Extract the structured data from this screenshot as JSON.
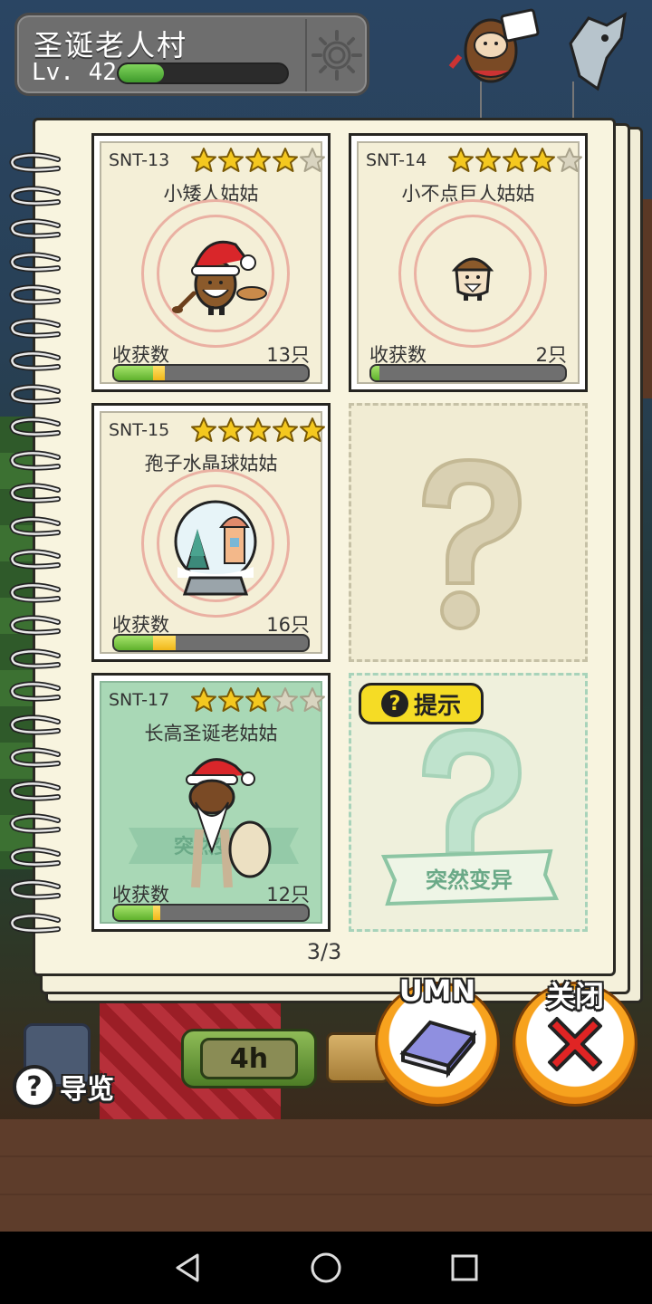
{
  "hud": {
    "village_name": "圣诞老人村",
    "level_text": "Lv. 42",
    "xp_progress": 0.27
  },
  "cards": [
    {
      "id": "SNT-13",
      "stars": 4,
      "name": "小矮人姑姑",
      "harvest_label": "收获数",
      "count": "13只",
      "progress_green": 0.2,
      "progress_yellow": 0.06,
      "style": "normal"
    },
    {
      "id": "SNT-14",
      "stars": 4,
      "name": "小不点巨人姑姑",
      "harvest_label": "收获数",
      "count": "2只",
      "progress_green": 0.04,
      "progress_yellow": 0.0,
      "style": "normal"
    },
    {
      "id": "SNT-15",
      "stars": 5,
      "name": "孢子水晶球姑姑",
      "harvest_label": "收获数",
      "count": "16只",
      "progress_green": 0.2,
      "progress_yellow": 0.12,
      "style": "normal"
    },
    {
      "id": "SNT-17",
      "stars": 3,
      "name": "长高圣诞老姑姑",
      "harvest_label": "收获数",
      "count": "12只",
      "progress_green": 0.2,
      "progress_yellow": 0.04,
      "style": "mutation",
      "ribbon": "突然变异"
    }
  ],
  "mystery_slots": [
    {
      "type": "unknown"
    },
    {
      "type": "hint",
      "hint_label": "提示",
      "ribbon": "突然变异"
    }
  ],
  "page_indicator": "3/3",
  "bottom": {
    "guide_label": "导览",
    "timer_text": "4h",
    "umn_label": "UMN",
    "close_label": "关闭"
  },
  "icons": [
    "settings-gear-icon",
    "question-icon",
    "book-icon",
    "close-x-icon",
    "back-icon",
    "home-icon",
    "recents-icon"
  ],
  "colors": {
    "card_bg": "#f4efd7",
    "card_green_bg": "#a9d8b6",
    "star_gold": "#f4c81f",
    "hint_yellow": "#f5dc25",
    "orange_button": "#f7a21e",
    "close_red": "#e02424"
  }
}
